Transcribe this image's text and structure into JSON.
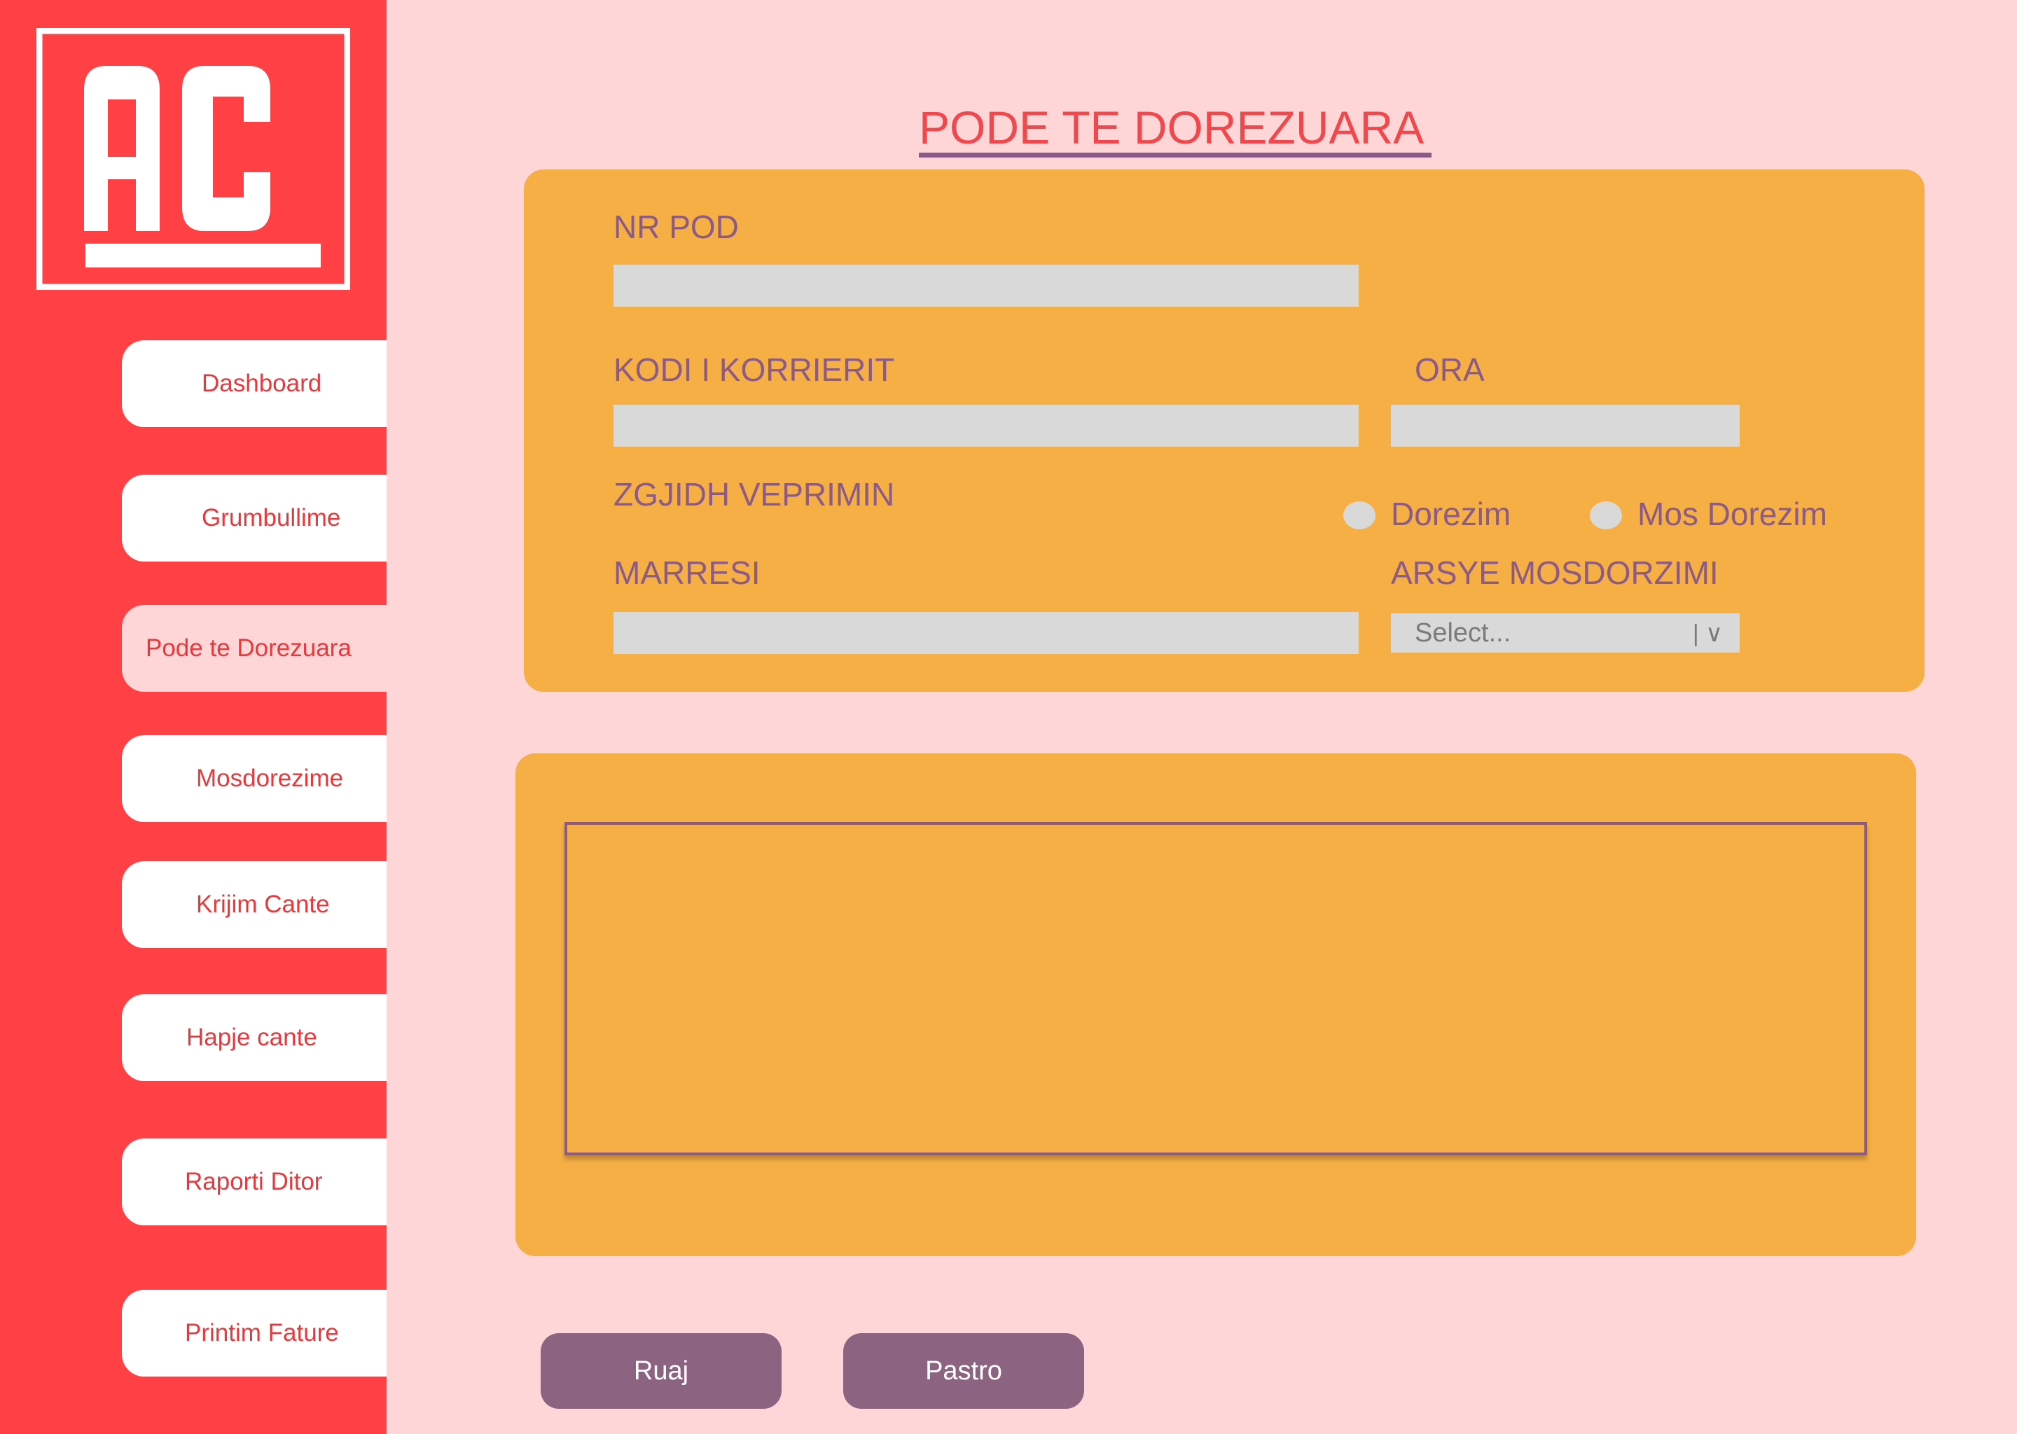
{
  "colors": {
    "sidebar_bg": "#FF4044",
    "page_bg": "#FFD6D8",
    "panel_bg": "#F5AF45",
    "label_color": "#8C5A86",
    "title_color": "#F0484C",
    "button_bg": "#8C6380",
    "input_bg": "#D9D9D9"
  },
  "logo": {
    "text": "AC"
  },
  "sidebar": {
    "items": [
      {
        "label": "Dashboard",
        "active": false
      },
      {
        "label": "Grumbullime",
        "active": false
      },
      {
        "label": "Pode te Dorezuara",
        "active": true
      },
      {
        "label": "Mosdorezime",
        "active": false
      },
      {
        "label": "Krijim Cante",
        "active": false
      },
      {
        "label": "Hapje cante",
        "active": false
      },
      {
        "label": "Raporti Ditor",
        "active": false
      },
      {
        "label": "Printim Fature",
        "active": false
      }
    ]
  },
  "page": {
    "title": "PODE TE DOREZUARA"
  },
  "form": {
    "nr_pod_label": "NR POD",
    "nr_pod_value": "",
    "kodi_label": "KODI I KORRIERIT",
    "kodi_value": "",
    "ora_label": "ORA",
    "ora_value": "",
    "veprimi_label": "ZGJIDH VEPRIMIN",
    "radio_options": [
      "Dorezim",
      "Mos Dorezim"
    ],
    "marresi_label": "MARRESI",
    "marresi_value": "",
    "arsye_label": "ARSYE MOSDORZIMI",
    "arsye_select": {
      "value": "Select...",
      "caret": "| ∨"
    }
  },
  "buttons": {
    "save": "Ruaj",
    "clear": "Pastro"
  }
}
